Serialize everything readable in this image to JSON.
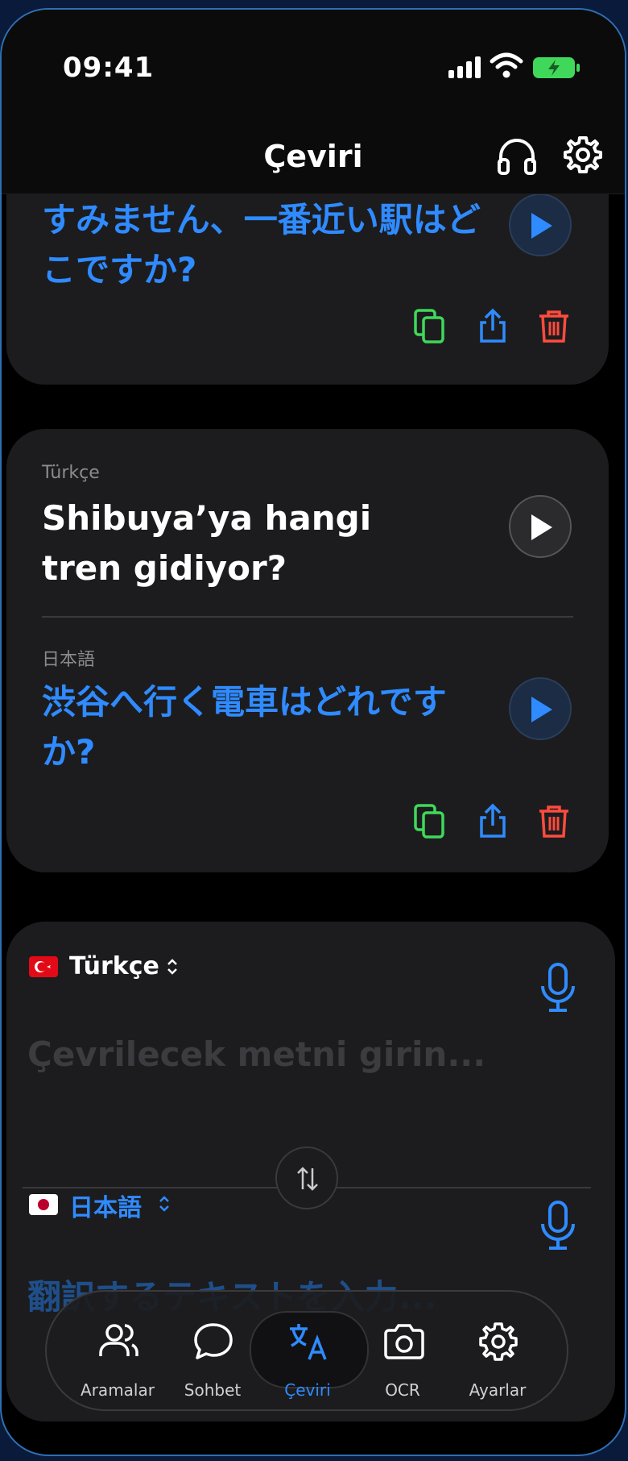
{
  "status": {
    "time": "09:41"
  },
  "nav": {
    "title": "Çeviri"
  },
  "card1": {
    "translation": "すみません、一番近い駅はどこですか?"
  },
  "card2": {
    "source_lang": "Türkçe",
    "source_text": "Shibuya’ya hangi tren gidiyor?",
    "target_lang": "日本語",
    "target_text": "渋谷へ行く電車はどれですか?"
  },
  "input": {
    "source_lang": "Türkçe",
    "source_placeholder": "Çevrilecek metni girin...",
    "target_lang": "日本語",
    "target_placeholder": "翻訳するテキストを入力..."
  },
  "tabs": [
    {
      "label": "Aramalar",
      "icon": "users-icon"
    },
    {
      "label": "Sohbet",
      "icon": "chat-bubble-icon"
    },
    {
      "label": "Çeviri",
      "icon": "translate-icon"
    },
    {
      "label": "OCR",
      "icon": "camera-icon"
    },
    {
      "label": "Ayarlar",
      "icon": "gear-icon"
    }
  ],
  "colors": {
    "accent": "#2f8bff",
    "copy": "#3fd85a",
    "delete": "#ff4b3e",
    "battery": "#3fd85a"
  }
}
